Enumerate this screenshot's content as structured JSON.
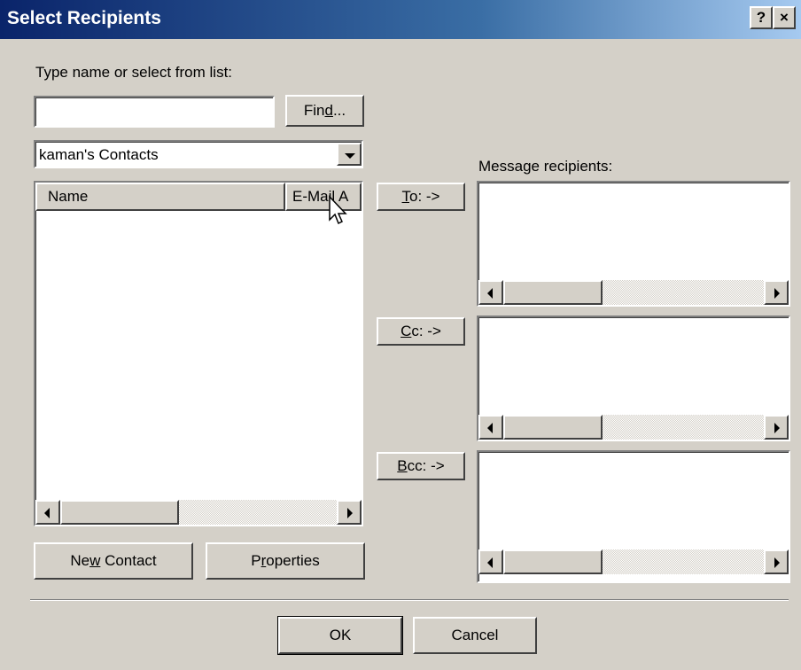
{
  "window": {
    "title": "Select Recipients",
    "help_button": "?",
    "close_button": "×"
  },
  "search": {
    "label": "Type name or select from list:",
    "value": "",
    "find_button": "Find..."
  },
  "address_book": {
    "selected": "kaman's Contacts"
  },
  "contact_list": {
    "columns": [
      "Name",
      "E-Mail A"
    ],
    "rows": []
  },
  "actions": {
    "to_button": "To: ->",
    "cc_button": "Cc: ->",
    "bcc_button": "Bcc: ->"
  },
  "recipients": {
    "label": "Message recipients:",
    "to": [],
    "cc": [],
    "bcc": []
  },
  "bottom_buttons": {
    "new_contact": "New Contact",
    "properties": "Properties",
    "ok": "OK",
    "cancel": "Cancel"
  }
}
